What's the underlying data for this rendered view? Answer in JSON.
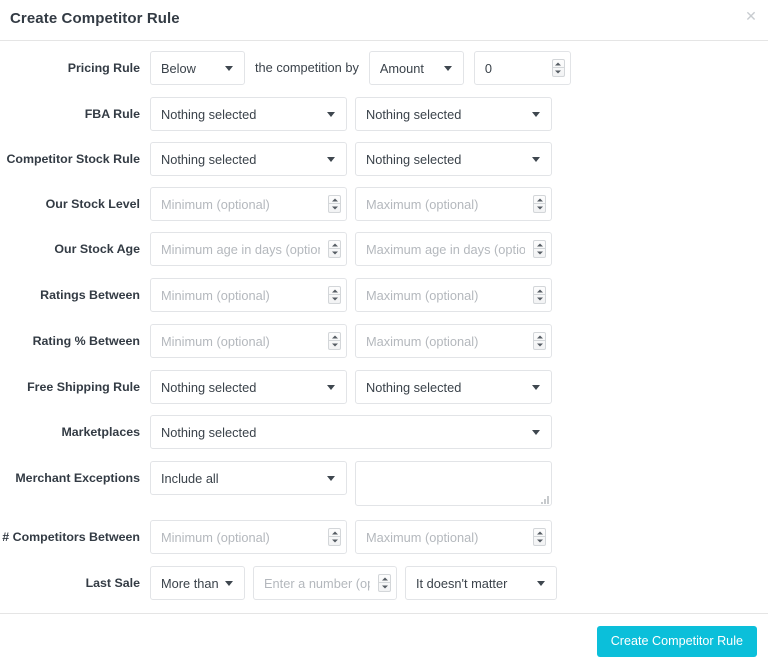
{
  "modal": {
    "title": "Create Competitor Rule",
    "close_icon": "close-icon",
    "submit_label": "Create Competitor Rule",
    "accent_color": "#0bbfda"
  },
  "rows": {
    "pricing_rule": {
      "label": "Pricing Rule",
      "direction_value": "Below",
      "middle_text": "the competition by",
      "mode_value": "Amount",
      "amount_value": "0"
    },
    "fba_rule": {
      "label": "FBA Rule",
      "left_value": "Nothing selected",
      "right_value": "Nothing selected"
    },
    "competitor_stock_rule": {
      "label": "Competitor Stock Rule",
      "left_value": "Nothing selected",
      "right_value": "Nothing selected"
    },
    "our_stock_level": {
      "label": "Our Stock Level",
      "min_placeholder": "Minimum (optional)",
      "max_placeholder": "Maximum (optional)"
    },
    "our_stock_age": {
      "label": "Our Stock Age",
      "min_placeholder": "Minimum age in days (optional)",
      "max_placeholder": "Maximum age in days (optional)"
    },
    "ratings_between": {
      "label": "Ratings Between",
      "min_placeholder": "Minimum (optional)",
      "max_placeholder": "Maximum (optional)"
    },
    "rating_pct_between": {
      "label": "Rating % Between",
      "min_placeholder": "Minimum (optional)",
      "max_placeholder": "Maximum (optional)"
    },
    "free_shipping_rule": {
      "label": "Free Shipping Rule",
      "left_value": "Nothing selected",
      "right_value": "Nothing selected"
    },
    "marketplaces": {
      "label": "Marketplaces",
      "value": "Nothing selected"
    },
    "merchant_exceptions": {
      "label": "Merchant Exceptions",
      "mode_value": "Include all",
      "list_value": ""
    },
    "competitors_between": {
      "label": "# Competitors Between",
      "min_placeholder": "Minimum (optional)",
      "max_placeholder": "Maximum (optional)"
    },
    "last_sale": {
      "label": "Last Sale",
      "comparator_value": "More than",
      "number_placeholder": "Enter a number (optional)",
      "period_value": "It doesn't matter"
    }
  }
}
